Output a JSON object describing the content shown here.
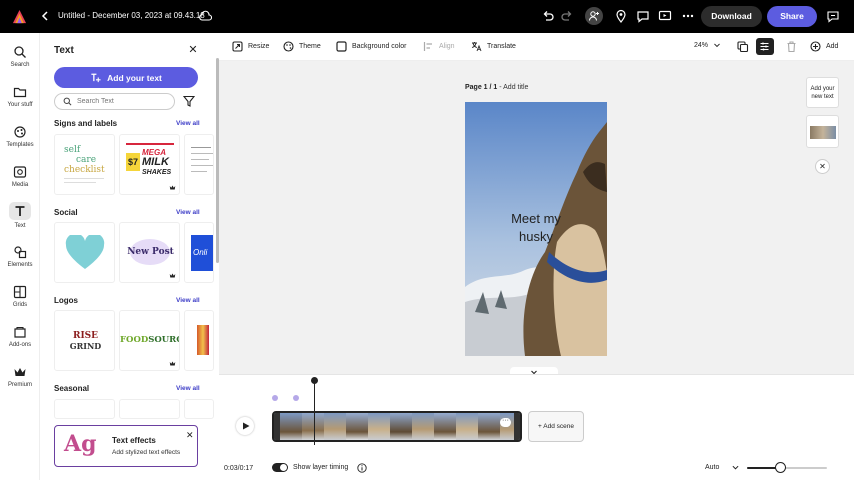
{
  "app": {
    "doc_title": "Untitled - December 03, 2023 at 09.43.18",
    "download_label": "Download",
    "share_label": "Share",
    "brand_color": "#5c5ce0"
  },
  "rail": {
    "items": [
      {
        "label": "Search",
        "icon": "search-icon"
      },
      {
        "label": "Your stuff",
        "icon": "folder-icon"
      },
      {
        "label": "Templates",
        "icon": "templates-icon"
      },
      {
        "label": "Media",
        "icon": "media-icon"
      },
      {
        "label": "Text",
        "icon": "text-icon",
        "active": true
      },
      {
        "label": "Elements",
        "icon": "elements-icon"
      },
      {
        "label": "Grids",
        "icon": "grids-icon"
      },
      {
        "label": "Add-ons",
        "icon": "addons-icon"
      },
      {
        "label": "Premium",
        "icon": "crown-icon"
      }
    ]
  },
  "panel": {
    "title": "Text",
    "add_text_label": "Add your text",
    "search_placeholder": "Search Text",
    "view_all": "View all",
    "sections": [
      {
        "title": "Signs and labels",
        "thumbs": [
          "self care checklist",
          "$7 MEGA MILK SHAKES",
          ""
        ]
      },
      {
        "title": "Social",
        "thumbs": [
          "",
          "New Post",
          "Onli"
        ]
      },
      {
        "title": "Logos",
        "thumbs": [
          "RISE GRIND",
          "FOOD SOURCE",
          ""
        ]
      },
      {
        "title": "Seasonal",
        "thumbs": []
      }
    ],
    "thumb_text": {
      "self_care_1": "self",
      "self_care_2": "care",
      "self_care_3": "checklist",
      "price": "$7",
      "mega": "MEGA",
      "milk": "MILK",
      "shakes": "SHAKES",
      "new_post": "New Post",
      "onli": "Onli",
      "rise": "RISE",
      "grind": "GRIND",
      "food": "FOOD",
      "source": "SOURCE"
    },
    "text_effects": {
      "glyph": "Ag",
      "title": "Text effects",
      "subtitle": "Add stylized text effects"
    }
  },
  "toolbar": {
    "resize": "Resize",
    "theme": "Theme",
    "background_color": "Background color",
    "align": "Align",
    "translate": "Translate",
    "zoom": "24%",
    "add": "Add"
  },
  "canvas": {
    "page_number": "Page 1 / 1",
    "add_title": " - Add title",
    "page_text_line1": "Meet my",
    "page_text_line2": "husky",
    "side_add_text_line1": "Add your",
    "side_add_text_line2": "new text"
  },
  "timeline": {
    "time": "0:03/0:17",
    "add_scene": "+ Add scene",
    "show_layer_timing": "Show layer timing",
    "zoom_mode": "Auto",
    "zoom_level": 0.41,
    "clip_more": "···"
  }
}
